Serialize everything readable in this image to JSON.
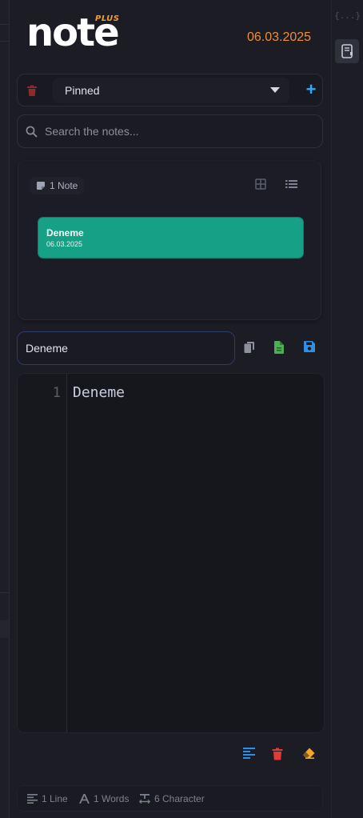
{
  "header": {
    "logo_text": "note",
    "logo_badge": "PLUS",
    "date": "06.03.2025"
  },
  "side_panel": {
    "code_icon_text": "{...}"
  },
  "pinned_select": {
    "selected": "Pinned"
  },
  "search": {
    "placeholder": "Search the notes...",
    "value": ""
  },
  "notes_list": {
    "count_label": "1 Note",
    "notes": [
      {
        "title": "Deneme",
        "date": "06.03.2025"
      }
    ]
  },
  "editor": {
    "title_value": "Deneme",
    "lines": [
      {
        "number": "1",
        "text": "Deneme"
      }
    ]
  },
  "status_bar": {
    "lines": "1 Line",
    "words": "1 Words",
    "characters": "6 Character"
  },
  "colors": {
    "accent_orange": "#ee8f39",
    "note_card": "#16a085",
    "add_blue": "#3aa6f0",
    "delete_red": "#e53935",
    "file_green": "#4caf50",
    "eraser_orange": "#f5a623",
    "trash_dark_red": "#8e2a2a"
  }
}
